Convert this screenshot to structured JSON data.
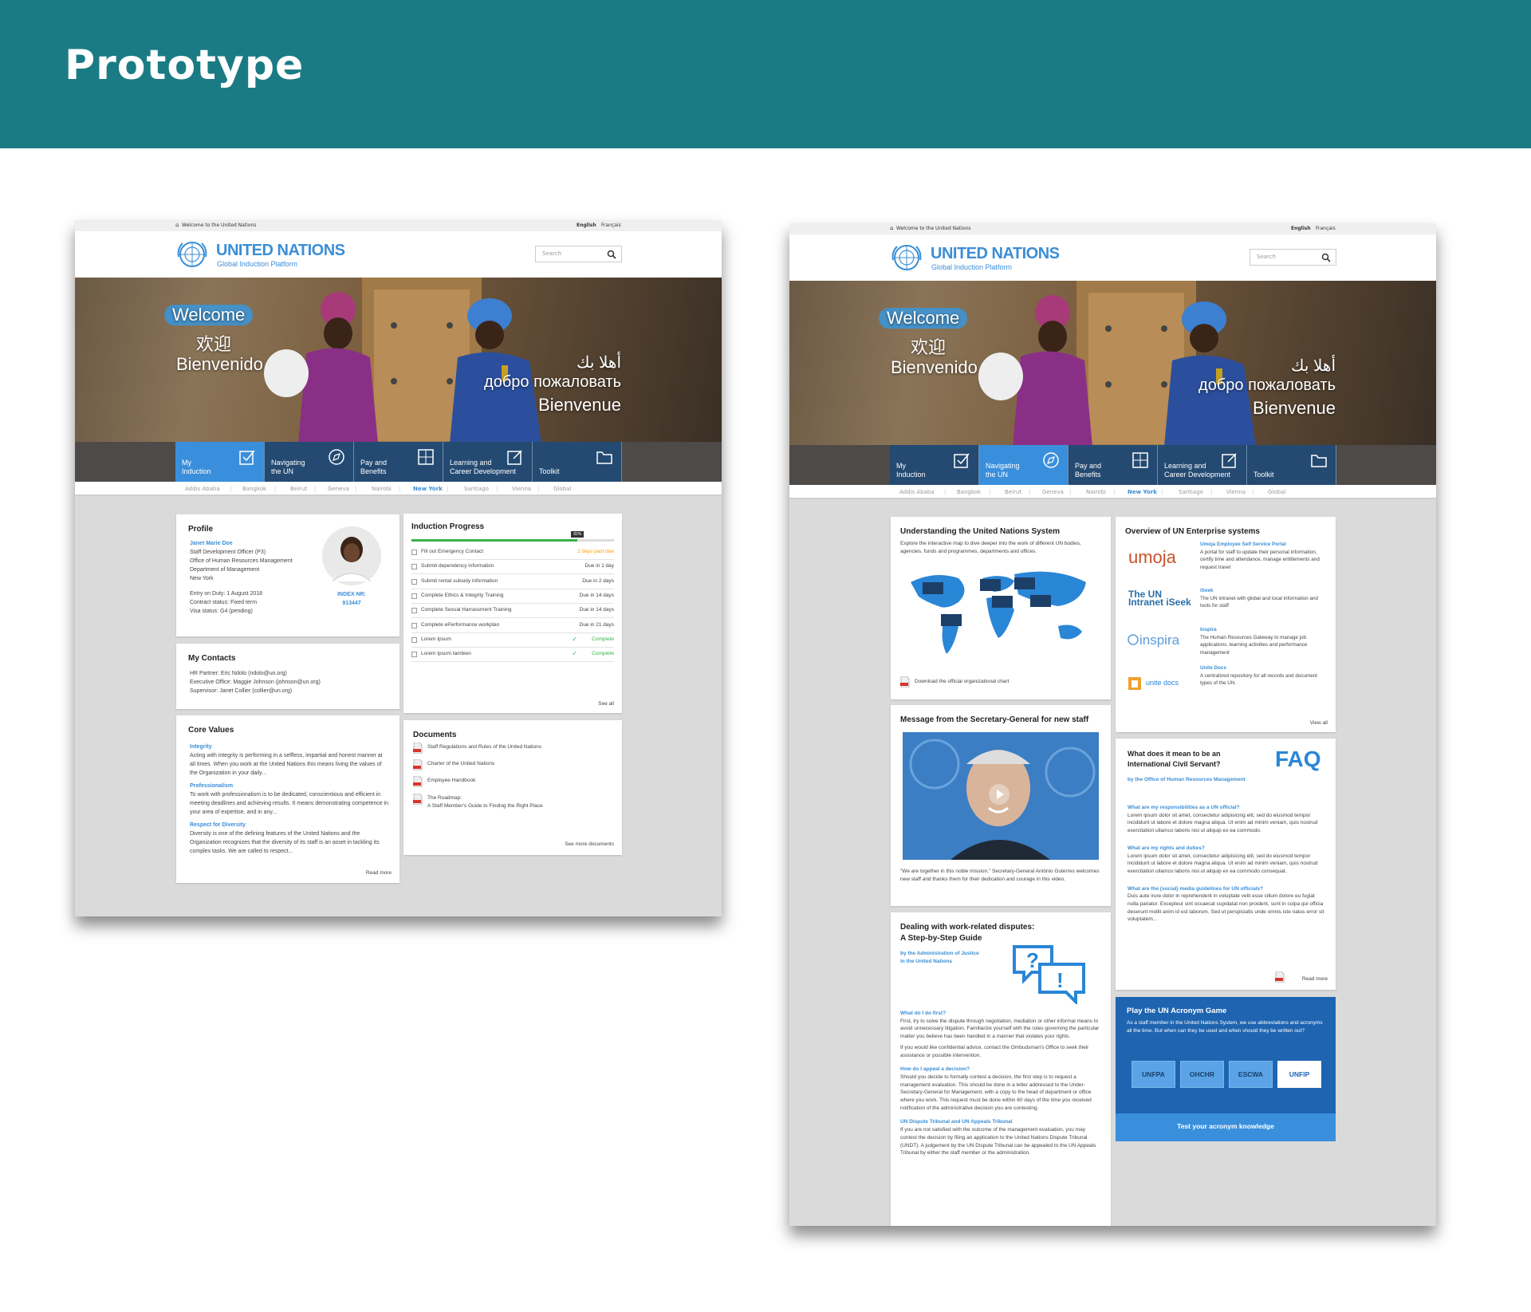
{
  "page_title": "Prototype",
  "site": {
    "topbar_welcome": "Welcome to the United Nations",
    "lang_en": "English",
    "lang_fr": "Français",
    "logo_name": "UNITED NATIONS",
    "logo_sub": "Global Induction Platform",
    "search_placeholder": "Search",
    "hero": {
      "welcome": "Welcome",
      "zh": "欢迎",
      "es": "Bienvenido",
      "ar": "أهلا بك",
      "ru": "добро пожаловать",
      "fr": "Bienvenue"
    },
    "tabs": [
      {
        "label": "My\nInduction",
        "icon": "checkbox-icon"
      },
      {
        "label": "Navigating\nthe UN",
        "icon": "compass-icon"
      },
      {
        "label": "Pay and\nBenefits",
        "icon": "calculator-icon"
      },
      {
        "label": "Learning and\nCareer Development",
        "icon": "edit-icon"
      },
      {
        "label": "Toolkit",
        "icon": "folder-icon"
      }
    ],
    "cities": [
      "Addis Ababa",
      "Bangkok",
      "Beirut",
      "Geneva",
      "Nairobi",
      "New York",
      "Santiago",
      "Vienna",
      "Global"
    ]
  },
  "mockA": {
    "profile": {
      "title": "Profile",
      "name": "Janet Marie Doe",
      "line1": "Staff Development Officer (P3)",
      "line2": "Office of Human Resources Management",
      "line3": "Department of Management",
      "line4": "New York",
      "entry": "Entry on Duty: 1 August 2018",
      "contract": "Contract status: Fixed term",
      "visa": "Visa status: G4 (pending)",
      "index_label": "INDEX NR:",
      "index_value": "913447"
    },
    "contacts": {
      "title": "My Contacts",
      "hr": "HR Partner: Eric Ndolo (ndolo@un.org)",
      "exec": "Executive Office: Maggie Johnson (johnson@un.org)",
      "sup": "Supervisor: Janet Collier (collier@un.org)"
    },
    "values": {
      "title": "Core Values",
      "items": [
        {
          "h": "Integrity",
          "t": "Acting with integrity is performing in a selfless, impartial and honest manner at all times. When you work at the United Nations this means living the values of the Organization in your daily..."
        },
        {
          "h": "Professionalism",
          "t": "To work with professionalism is to be dedicated, conscientious and efficient in meeting deadlines and achieving results. It means demonstrating competence in your area of expertise, and in any..."
        },
        {
          "h": "Respect for Diversity",
          "t": "Diversity is one of the defining features of the United Nations and the Organization recognizes that the diversity of its staff is an asset in tackling its complex tasks. We are called to respect..."
        }
      ],
      "more": "Read more"
    },
    "progress": {
      "title": "Induction Progress",
      "percent_label": "82%",
      "fraction": 0.82,
      "rows": [
        {
          "task": "Fill out Emergency Contact",
          "due": "2 days past due",
          "state": "overdue"
        },
        {
          "task": "Submit dependency information",
          "due": "Due in 1 day",
          "state": "due"
        },
        {
          "task": "Submit rental subsidy information",
          "due": "Due in 2 days",
          "state": "due"
        },
        {
          "task": "Complete Ethics & Integrity Training",
          "due": "Due in 14 days",
          "state": "due"
        },
        {
          "task": "Complete Sexual Harrassment Training",
          "due": "Due in 14 days",
          "state": "due"
        },
        {
          "task": "Complete ePerformance workplan",
          "due": "Due in 21 days",
          "state": "due"
        },
        {
          "task": "Lorem Ipsum",
          "due": "Complete",
          "state": "done"
        },
        {
          "task": "Lorem Ipsum tambien",
          "due": "Complete",
          "state": "done"
        }
      ],
      "see_all": "See all"
    },
    "documents": {
      "title": "Documents",
      "items": [
        "Staff Regulations and Rules of the United Nations",
        "Charter of the United Nations",
        "Employee Handbook",
        "The Roadmap:\nA Staff Member's Guide to Finding the Right Place"
      ],
      "more": "See more documents"
    }
  },
  "mockB": {
    "system": {
      "title": "Understanding the United Nations System",
      "desc": "Explore the interactive map to dive deeper into the work of different UN bodies, agencies, funds and programmes, departments and offices.",
      "download": "Download the official organizational chart"
    },
    "message": {
      "title": "Message from the Secretary-General for new staff",
      "caption": "\"We are together in this noble mission,\" Secretary-General António Guterres welcomes new staff and thanks them for their dedication and courage in this video."
    },
    "disputes": {
      "title1": "Dealing with work-related disputes:",
      "title2": "A Step-by-Step Guide",
      "by": "by the Administration of Justice\nin the United Nations",
      "q1": "What do I do first?",
      "a1": "First, try to solve the dispute through negotiation, mediation or other informal means to avoid unnecessary litigation. Familiarize yourself with the rules governing the particular matter you believe has been handled in a manner that violates your rights.",
      "a1b": "If you would like confidential advice, contact the Ombudsman's Office to seek their assistance or possible intervention.",
      "q2": "How do I appeal a decision?",
      "a2": "Should you decide to formally contest a decision, the first step is to request a management evaluation. This should be done in a letter addressed to the Under-Secretary-General for Management, with a copy to the head of department or office where you work. This request must be done within 60 days of the time you received notification of the administrative decision you are contesting.",
      "q3": "UN Dispute Tribunal and UN Appeals Tribunal",
      "a3": "If you are not satisfied with the outcome of the management evaluation, you may contest the decision by filing an application to the United Nations Dispute Tribunal (UNDT). A judgement by the UN Dispute Tribunal can be appealed to the UN Appeals Tribunal by either the staff member or the administration."
    },
    "enterprise": {
      "title": "Overview of UN Enterprise systems",
      "items": [
        {
          "logo": "umoja",
          "h": "Umoja Employee Self Service Portal",
          "t": "A portal for staff to update their personal information, certify time and attendance, manage entitlements and request travel"
        },
        {
          "logo": "The UN Intranet iSeek",
          "h": "iSeek",
          "t": "The UN intranet with global and local information and tools for staff"
        },
        {
          "logo": "inspira",
          "h": "Inspira",
          "t": "The Human Resources Gateway to manage job applications, learning activities and performance management"
        },
        {
          "logo": "unite docs",
          "h": "Unite Docs",
          "t": "A centralized repository for all records and document types of the UN."
        }
      ],
      "view_all": "View all"
    },
    "faq": {
      "title": "What does it mean to be an International Civil Servant?",
      "badge": "FAQ",
      "by": "by the Office of Human Resources Management",
      "items": [
        {
          "q": "What are my responsibilities as a UN official?",
          "a": "Lorem ipsum dolor sit amet, consectetur adipisicing elit, sed do eiusmod tempor incididunt ut labore et dolore magna aliqua. Ut enim ad minim veniam, quis nostrud exercitation ullamco laboris nisi ut aliquip ex ea commodo."
        },
        {
          "q": "What are my rights and duties?",
          "a": "Lorem ipsum dolor sit amet, consectetur adipisicing elit, sed do eiusmod tempor incididunt ut labore et dolore magna aliqua. Ut enim ad minim veniam, quis nostrud exercitation ullamco laboris nisi ut aliquip ex ea commodo consequat."
        },
        {
          "q": "What are the (social) media guidelines for UN officials?",
          "a": "Duis aute irure dolor in reprehenderit in voluptate velit esse cillum dolore eu fugiat nulla pariatur. Excepteur sint occaecat cupidatat non proident, sunt in culpa qui officia deserunt mollit anim id est laborum. Sed ut perspiciatis unde omnis iste natus error sit voluptatem..."
        }
      ],
      "more": "Read more"
    },
    "game": {
      "title": "Play the UN Acronym Game",
      "desc": "As a staff member in the United Nations System, we use abbreviations and acronyms all the time. But when can they be used and when should they be written out?",
      "chips": [
        "UNFPA",
        "OHCHR",
        "ESCWA",
        "UNFIP"
      ],
      "cta": "Test your acronym knowledge"
    }
  }
}
